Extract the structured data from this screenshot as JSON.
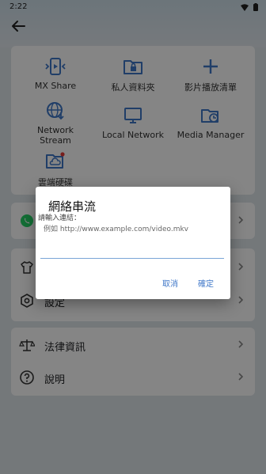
{
  "status_bar": {
    "time": "2:22",
    "wifi_icon": "wifi-icon",
    "battery_icon": "battery-icon"
  },
  "header": {
    "back_icon": "arrow-left-icon"
  },
  "grid": {
    "items": [
      {
        "label": "MX Share",
        "icon": "mx-share-icon"
      },
      {
        "label": "私人資料夾",
        "icon": "private-folder-icon"
      },
      {
        "label": "影片播放清單",
        "icon": "plus-icon"
      },
      {
        "label": "Network\nStream",
        "icon": "globe-download-icon"
      },
      {
        "label": "Local Network",
        "icon": "monitor-icon"
      },
      {
        "label": "Media Manager",
        "icon": "media-manager-icon"
      },
      {
        "label": "雲端硬碟",
        "icon": "cloud-drive-icon"
      }
    ]
  },
  "menu": {
    "row_settings": {
      "label": "設定",
      "icon": "gear-icon"
    },
    "row_legal": {
      "label": "法律資訊",
      "icon": "scale-icon"
    },
    "row_help": {
      "label": "說明",
      "icon": "help-icon"
    }
  },
  "dialog": {
    "title": "網絡串流",
    "label": "請輸入連結：",
    "hint": "例如 http://www.example.com/video.mkv",
    "input_value": "",
    "cancel": "取消",
    "confirm": "確定"
  },
  "colors": {
    "accent": "#3f77c8",
    "whatsapp_green": "#25d366",
    "badge_red": "#e53935"
  }
}
